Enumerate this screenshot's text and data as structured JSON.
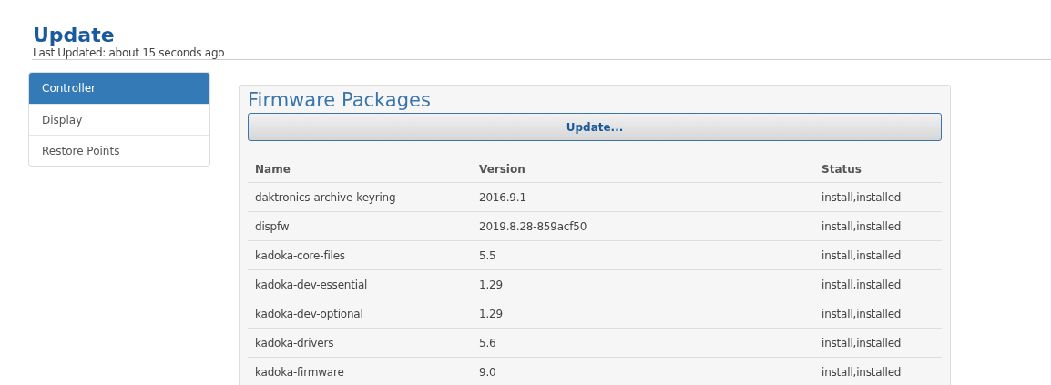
{
  "header": {
    "title": "Update",
    "subtitle": "Last Updated: about 15 seconds ago"
  },
  "sidebar": {
    "items": [
      {
        "label": "Controller",
        "selected": true
      },
      {
        "label": "Display",
        "selected": false
      },
      {
        "label": "Restore Points",
        "selected": false
      }
    ]
  },
  "panel": {
    "title": "Firmware Packages",
    "button": "Update...",
    "table": {
      "columns": [
        "Name",
        "Version",
        "Status"
      ],
      "rows": [
        [
          "daktronics-archive-keyring",
          "2016.9.1",
          "install,installed"
        ],
        [
          "dispfw",
          "2019.8.28-859acf50",
          "install,installed"
        ],
        [
          "kadoka-core-files",
          "5.5",
          "install,installed"
        ],
        [
          "kadoka-dev-essential",
          "1.29",
          "install,installed"
        ],
        [
          "kadoka-dev-optional",
          "1.29",
          "install,installed"
        ],
        [
          "kadoka-drivers",
          "5.6",
          "install,installed"
        ],
        [
          "kadoka-firmware",
          "9.0",
          "install,installed"
        ]
      ]
    }
  }
}
